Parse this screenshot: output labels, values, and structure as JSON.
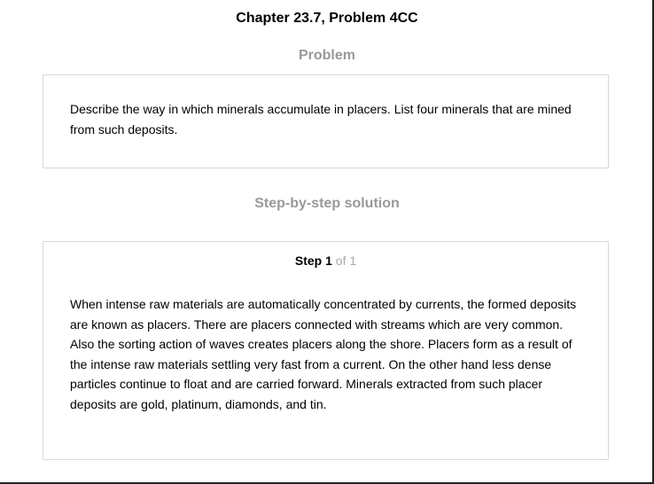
{
  "header": {
    "title": "Chapter 23.7, Problem 4CC"
  },
  "problem": {
    "heading": "Problem",
    "text": "Describe the way in which minerals accumulate in placers. List four minerals that are mined from such deposits."
  },
  "solution": {
    "heading": "Step-by-step solution",
    "step_word": "Step",
    "step_current": "1",
    "step_of": "of 1",
    "text": "When intense raw materials are automatically concentrated by currents, the formed deposits are known as placers. There are placers connected with streams which are very common. Also the sorting action of waves creates placers along the shore. Placers form as a result of the intense raw materials settling very fast from a current. On the other hand less dense particles continue to float and are carried forward. Minerals extracted from such placer deposits are gold, platinum, diamonds, and tin."
  },
  "colors": {
    "heading_gray": "#999999",
    "step_of_gray": "#aaaaaa",
    "box_border": "#d9d9d9",
    "text": "#000000"
  }
}
